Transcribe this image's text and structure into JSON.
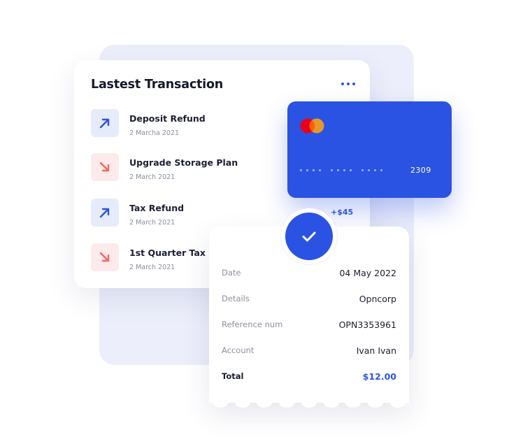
{
  "transactions_panel": {
    "title": "Lastest Transaction",
    "items": [
      {
        "name": "Deposit Refund",
        "date": "2 Marcha 2021",
        "direction": "incoming"
      },
      {
        "name": "Upgrade Storage Plan",
        "date": "2 March 2021",
        "direction": "outgoing"
      },
      {
        "name": "Tax Refund",
        "date": "2 March 2021",
        "direction": "incoming",
        "amount": "+$45"
      },
      {
        "name": "1st Quarter Tax",
        "date": "2 March 2021",
        "direction": "outgoing"
      }
    ]
  },
  "card": {
    "brand_icon": "mastercard-logo",
    "masked_groups": [
      "••••",
      "••••",
      "••••"
    ],
    "last4": "2309"
  },
  "receipt": {
    "status_icon": "check-icon",
    "rows": [
      {
        "label": "Date",
        "value": "04 May 2022"
      },
      {
        "label": "Details",
        "value": "Opncorp"
      },
      {
        "label": "Reference num",
        "value": "OPN3353961"
      },
      {
        "label": "Account",
        "value": "Ivan Ivan"
      }
    ],
    "total": {
      "label": "Total",
      "value": "$12.00"
    }
  },
  "colors": {
    "accent": "#2a53e4",
    "incoming_bg": "#e6ebfb",
    "outgoing_bg": "#fdeaea",
    "outgoing_arrow": "#f2665f",
    "mastercard_red": "#eb001b",
    "mastercard_orange": "#f79e1b"
  }
}
